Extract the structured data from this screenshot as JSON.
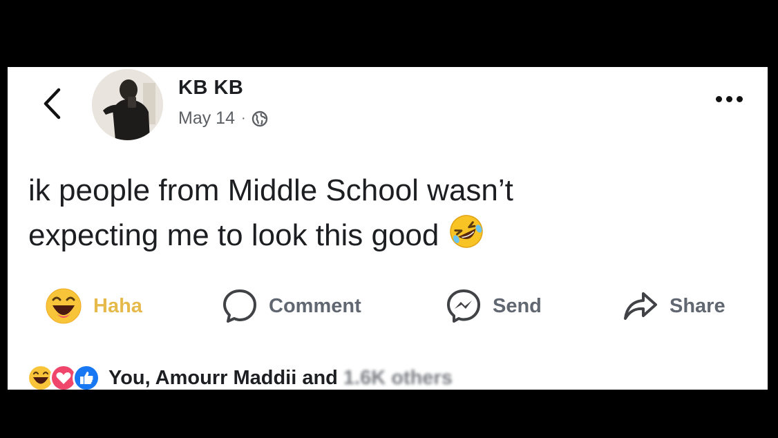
{
  "post": {
    "author": "KB KB",
    "date": "May 14",
    "separator": "·",
    "text_line1": "ik people from Middle School wasn’t",
    "text_line2": "expecting me to look this good"
  },
  "actions": {
    "haha": "Haha",
    "comment": "Comment",
    "send": "Send",
    "share": "Share"
  },
  "reactions": {
    "summary": "You, Amourr Maddii and",
    "summary_tail": "1.6K others"
  },
  "icons": [
    "back-chevron-icon",
    "globe-icon",
    "more-dots-icon",
    "rofl-emoji-icon",
    "haha-emoji-icon",
    "comment-bubble-icon",
    "messenger-icon",
    "share-arrow-icon",
    "love-reaction-icon",
    "like-reaction-icon"
  ],
  "colors": {
    "background": "#000000",
    "card": "#ffffff",
    "haha": "#e6b94b",
    "action_gray": "#606770",
    "like_blue": "#1877f2",
    "love_red": "#f0466b"
  }
}
